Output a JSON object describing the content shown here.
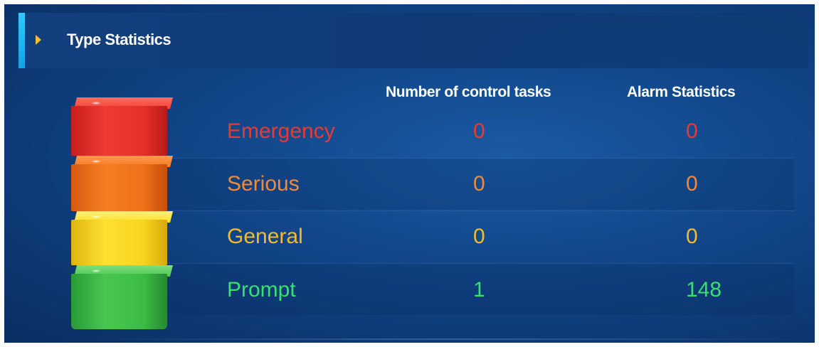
{
  "header": {
    "title": "Type Statistics"
  },
  "columns": {
    "tasks": "Number of control tasks",
    "alarms": "Alarm Statistics"
  },
  "rows": [
    {
      "label": "Emergency",
      "tasks": "0",
      "alarms": "0",
      "color": "#e83a34",
      "block_color": "#e5322b"
    },
    {
      "label": "Serious",
      "tasks": "0",
      "alarms": "0",
      "color": "#f08a38",
      "block_color": "#f0711a"
    },
    {
      "label": "General",
      "tasks": "0",
      "alarms": "0",
      "color": "#f6ba2c",
      "block_color": "#f7d21e"
    },
    {
      "label": "Prompt",
      "tasks": "1",
      "alarms": "148",
      "color": "#38e070",
      "block_color": "#3cbf4a"
    }
  ]
}
